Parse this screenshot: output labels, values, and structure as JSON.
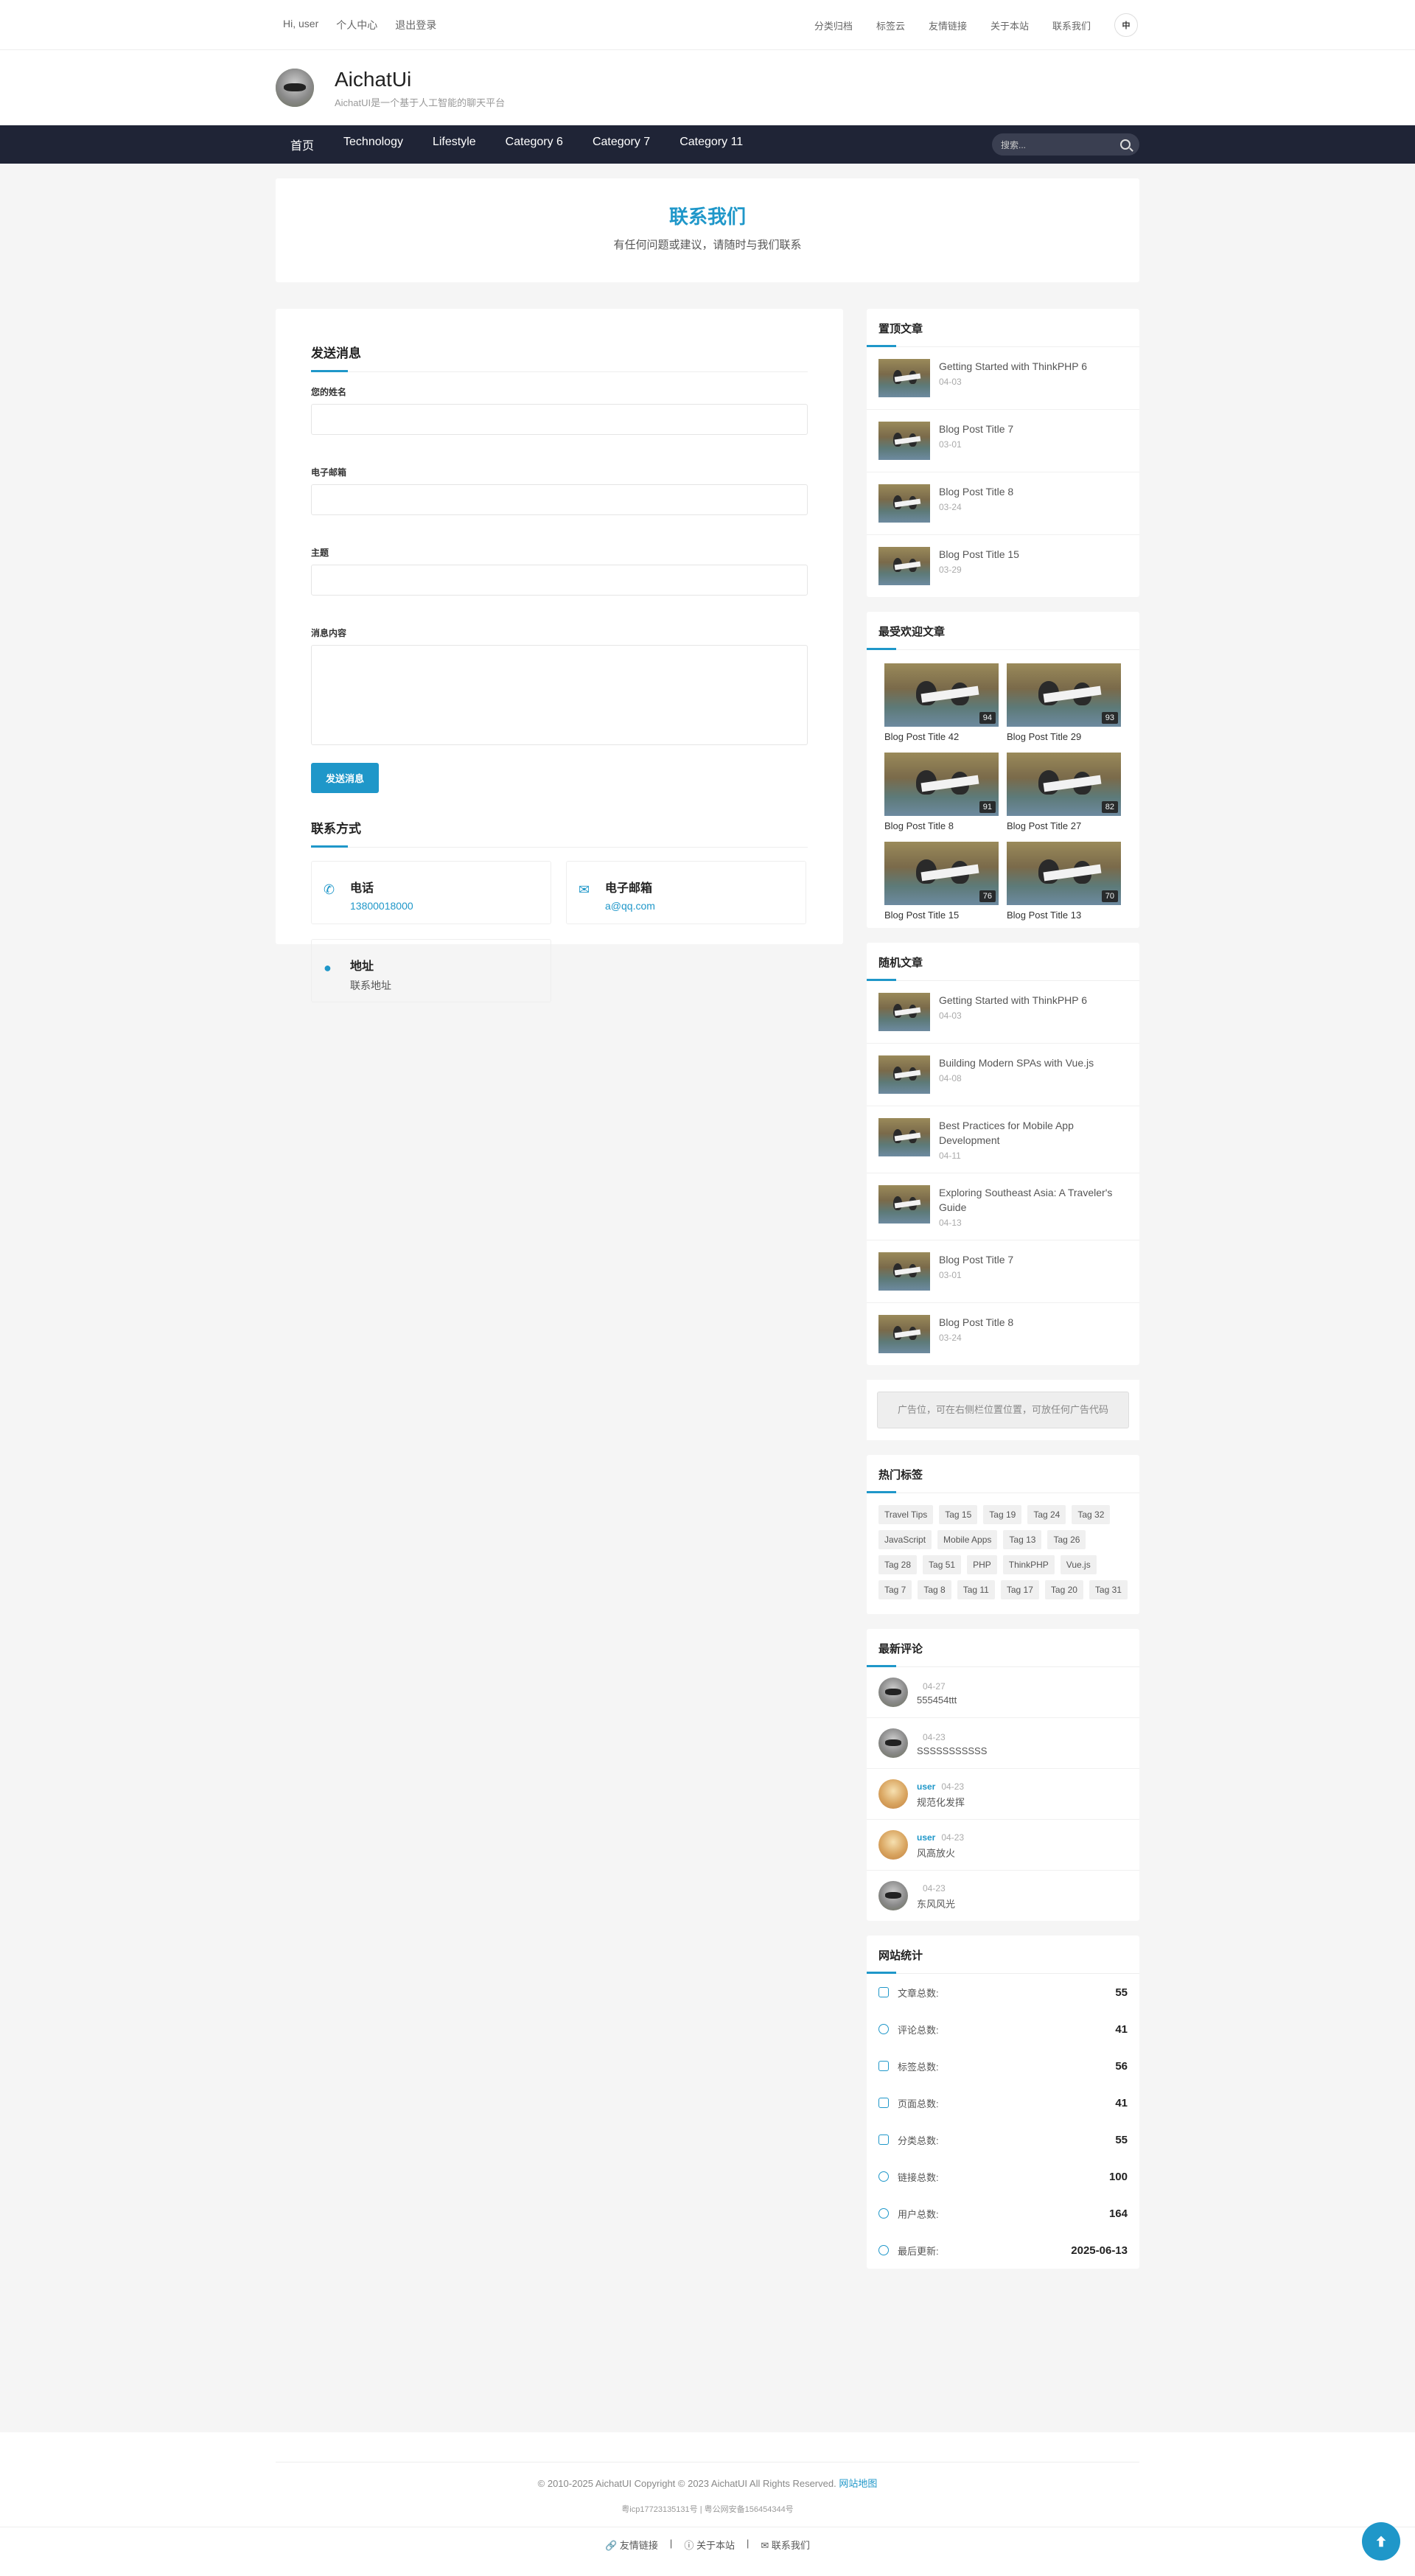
{
  "topbar": {
    "greeting": "Hi, user",
    "profile": "个人中心",
    "logout": "退出登录",
    "links": [
      "分类归档",
      "标签云",
      "友情链接",
      "关于本站",
      "联系我们"
    ],
    "lang": "中"
  },
  "site": {
    "title": "AichatUi",
    "subtitle": "AichatUI是一个基于人工智能的聊天平台"
  },
  "nav": {
    "items": [
      "首页",
      "Technology",
      "Lifestyle",
      "Category 6",
      "Category 7",
      "Category 11"
    ],
    "search_placeholder": "搜索..."
  },
  "banner": {
    "title": "联系我们",
    "subtitle": "有任何问题或建议，请随时与我们联系"
  },
  "form": {
    "title": "发送消息",
    "name_label": "您的姓名",
    "email_label": "电子邮箱",
    "subject_label": "主题",
    "message_label": "消息内容",
    "submit": "发送消息"
  },
  "contact": {
    "title": "联系方式",
    "phone_label": "电话",
    "phone": "13800018000",
    "email_label": "电子邮箱",
    "email": "a@qq.com",
    "address_label": "地址",
    "address": "联系地址"
  },
  "top_articles": {
    "title": "置顶文章",
    "items": [
      {
        "title": "Getting Started with ThinkPHP 6",
        "date": "04-03"
      },
      {
        "title": "Blog Post Title 7",
        "date": "03-01"
      },
      {
        "title": "Blog Post Title 8",
        "date": "03-24"
      },
      {
        "title": "Blog Post Title 15",
        "date": "03-29"
      }
    ]
  },
  "popular": {
    "title": "最受欢迎文章",
    "items": [
      {
        "title": "Blog Post Title 42",
        "count": "94"
      },
      {
        "title": "Blog Post Title 29",
        "count": "93"
      },
      {
        "title": "Blog Post Title 8",
        "count": "91"
      },
      {
        "title": "Blog Post Title 27",
        "count": "82"
      },
      {
        "title": "Blog Post Title 15",
        "count": "76"
      },
      {
        "title": "Blog Post Title 13",
        "count": "70"
      }
    ]
  },
  "random": {
    "title": "随机文章",
    "items": [
      {
        "title": "Getting Started with ThinkPHP 6",
        "date": "04-03"
      },
      {
        "title": "Building Modern SPAs with Vue.js",
        "date": "04-08"
      },
      {
        "title": "Best Practices for Mobile App Development",
        "date": "04-11"
      },
      {
        "title": "Exploring Southeast Asia: A Traveler's Guide",
        "date": "04-13"
      },
      {
        "title": "Blog Post Title 7",
        "date": "03-01"
      },
      {
        "title": "Blog Post Title 8",
        "date": "03-24"
      }
    ]
  },
  "ad": {
    "text": "广告位，可在右侧栏位置位置，可放任何广告代码"
  },
  "tags": {
    "title": "热门标签",
    "items": [
      "Travel Tips",
      "Tag 15",
      "Tag 19",
      "Tag 24",
      "Tag 32",
      "JavaScript",
      "Mobile Apps",
      "Tag 13",
      "Tag 26",
      "Tag 28",
      "Tag 51",
      "PHP",
      "ThinkPHP",
      "Vue.js",
      "Tag 7",
      "Tag 8",
      "Tag 11",
      "Tag 17",
      "Tag 20",
      "Tag 31"
    ]
  },
  "comments": {
    "title": "最新评论",
    "items": [
      {
        "user": "",
        "date": "04-27",
        "text": "555454ttt"
      },
      {
        "user": "",
        "date": "04-23",
        "text": "SSSSSSSSSSS"
      },
      {
        "user": "user",
        "date": "04-23",
        "text": "规范化发挥"
      },
      {
        "user": "user",
        "date": "04-23",
        "text": "风高放火"
      },
      {
        "user": "",
        "date": "04-23",
        "text": "东风风光"
      }
    ]
  },
  "stats": {
    "title": "网站统计",
    "items": [
      {
        "label": "文章总数:",
        "value": "55"
      },
      {
        "label": "评论总数:",
        "value": "41"
      },
      {
        "label": "标签总数:",
        "value": "56"
      },
      {
        "label": "页面总数:",
        "value": "41"
      },
      {
        "label": "分类总数:",
        "value": "55"
      },
      {
        "label": "链接总数:",
        "value": "100"
      },
      {
        "label": "用户总数:",
        "value": "164"
      },
      {
        "label": "最后更新:",
        "value": "2025-06-13"
      }
    ]
  },
  "footer": {
    "copyright": "© 2010-2025 AichatUI Copyright © 2023 AichatUI All Rights Reserved.",
    "sitemap": "网站地图",
    "icp": "粤icp17723135131号 | 粤公网安备156454344号",
    "links": [
      "友情链接",
      "关于本站",
      "联系我们"
    ]
  },
  "colors": {
    "accent": "#1f97c9",
    "nav_bg": "#1f2436"
  }
}
